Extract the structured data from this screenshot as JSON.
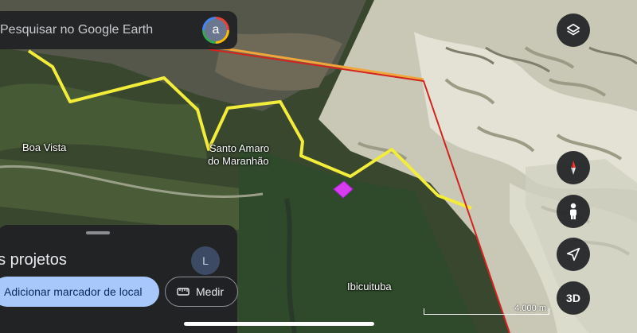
{
  "search": {
    "placeholder": "Pesquisar no Google Earth",
    "avatar_letter": "a"
  },
  "map": {
    "labels": {
      "boa_vista": "Boa Vista",
      "santo_amaro_line1": "Santo Amaro",
      "santo_amaro_line2": "do Maranhão",
      "ibicuituba": "Ibicuituba"
    },
    "scale_label": "4.000 m",
    "route_color": "#f2ec3a",
    "line_color": "#d2231f",
    "marker_color": "#d83cf0"
  },
  "controls": {
    "layers_icon": "layers-icon",
    "compass_icon": "compass-icon",
    "street_view_icon": "person-icon",
    "location_icon": "navigation-arrow-icon",
    "view_3d_label": "3D"
  },
  "panel": {
    "title": "us projetos",
    "avatar_letter": "L",
    "add_marker_label": "Adicionar marcador de local",
    "measure_label": "Medir",
    "accent_color": "#a8c7fa"
  }
}
